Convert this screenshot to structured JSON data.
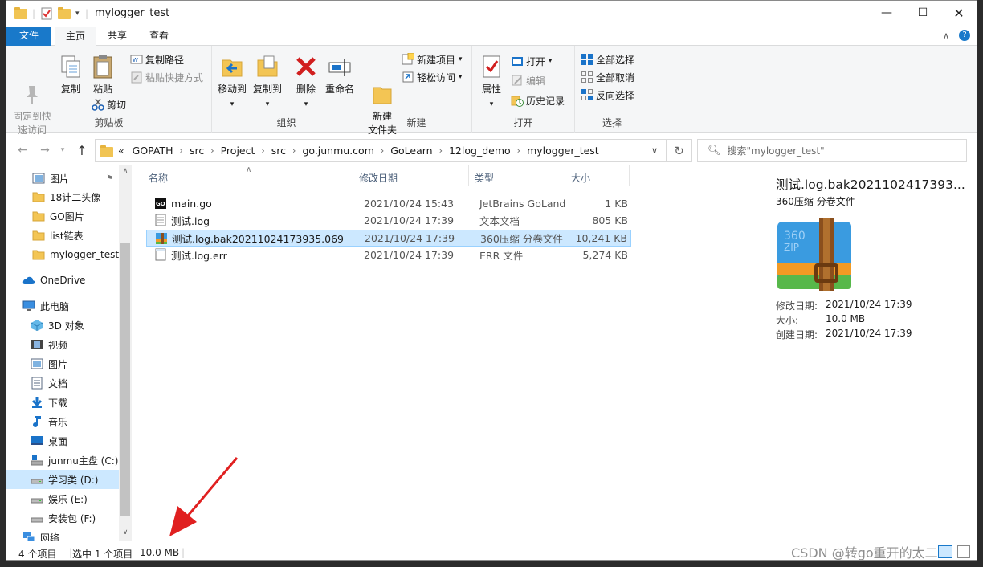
{
  "window": {
    "title": "mylogger_test"
  },
  "tabs": {
    "file": "文件",
    "home": "主页",
    "share": "共享",
    "view": "查看"
  },
  "ribbon": {
    "clipboard": {
      "pin": "固定到快\n速访问",
      "copy": "复制",
      "paste": "粘贴",
      "copy_path": "复制路径",
      "paste_shortcut": "粘贴快捷方式",
      "cut": "剪切",
      "label": "剪贴板"
    },
    "organize": {
      "move_to": "移动到",
      "copy_to": "复制到",
      "delete": "删除",
      "rename": "重命名",
      "label": "组织"
    },
    "new": {
      "new_folder": "新建\n文件夹",
      "new_item": "新建项目",
      "easy_access": "轻松访问",
      "label": "新建"
    },
    "open": {
      "properties": "属性",
      "open": "打开",
      "edit": "编辑",
      "history": "历史记录",
      "label": "打开"
    },
    "select": {
      "select_all": "全部选择",
      "select_none": "全部取消",
      "invert": "反向选择",
      "label": "选择"
    }
  },
  "address": {
    "back": "←",
    "forward": "→",
    "up": "↑",
    "crumbs": [
      "«",
      "GOPATH",
      "src",
      "Project",
      "src",
      "go.junmu.com",
      "GoLearn",
      "12log_demo",
      "mylogger_test"
    ],
    "search_placeholder": "搜索\"mylogger_test\""
  },
  "nav": {
    "items": [
      {
        "label": "图片",
        "icon": "pictures-icon"
      },
      {
        "label": "18计二头像",
        "icon": "folder-icon"
      },
      {
        "label": "GO图片",
        "icon": "folder-icon"
      },
      {
        "label": "list链表",
        "icon": "folder-icon"
      },
      {
        "label": "mylogger_test",
        "icon": "folder-icon"
      },
      {
        "label": "OneDrive",
        "icon": "cloud-icon"
      },
      {
        "label": "此电脑",
        "icon": "computer-icon"
      },
      {
        "label": "3D 对象",
        "icon": "cube-icon"
      },
      {
        "label": "视频",
        "icon": "video-icon"
      },
      {
        "label": "图片",
        "icon": "pictures-icon"
      },
      {
        "label": "文档",
        "icon": "document-icon"
      },
      {
        "label": "下载",
        "icon": "download-icon"
      },
      {
        "label": "音乐",
        "icon": "music-icon"
      },
      {
        "label": "桌面",
        "icon": "desktop-icon"
      },
      {
        "label": "junmu主盘 (C:)",
        "icon": "drive-c-icon"
      },
      {
        "label": "学习类 (D:)",
        "icon": "drive-icon"
      },
      {
        "label": "娱乐 (E:)",
        "icon": "drive-icon"
      },
      {
        "label": "安装包 (F:)",
        "icon": "drive-icon"
      },
      {
        "label": "网络",
        "icon": "network-icon"
      }
    ]
  },
  "columns": {
    "name": "名称",
    "date": "修改日期",
    "type": "类型",
    "size": "大小"
  },
  "files": [
    {
      "name": "main.go",
      "date": "2021/10/24 15:43",
      "type": "JetBrains GoLand",
      "size": "1 KB",
      "icon": "go-file-icon"
    },
    {
      "name": "测试.log",
      "date": "2021/10/24 17:39",
      "type": "文本文档",
      "size": "805 KB",
      "icon": "text-file-icon"
    },
    {
      "name": "测试.log.bak20211024173935.069",
      "date": "2021/10/24 17:39",
      "type": "360压缩 分卷文件",
      "size": "10,241 KB",
      "icon": "archive-icon"
    },
    {
      "name": "测试.log.err",
      "date": "2021/10/24 17:39",
      "type": "ERR 文件",
      "size": "5,274 KB",
      "icon": "err-file-icon"
    }
  ],
  "preview": {
    "title": "测试.log.bak2021102417393...",
    "subtitle": "360压缩 分卷文件",
    "zip_text": "360\nZIP",
    "details": [
      {
        "label": "修改日期:",
        "value": "2021/10/24 17:39"
      },
      {
        "label": "大小:",
        "value": "10.0 MB"
      },
      {
        "label": "创建日期:",
        "value": "2021/10/24 17:39"
      }
    ]
  },
  "status": {
    "count": "4 个项目",
    "selected": "选中 1 个项目",
    "size": "10.0 MB"
  },
  "watermark": "CSDN @转go重开的太二"
}
